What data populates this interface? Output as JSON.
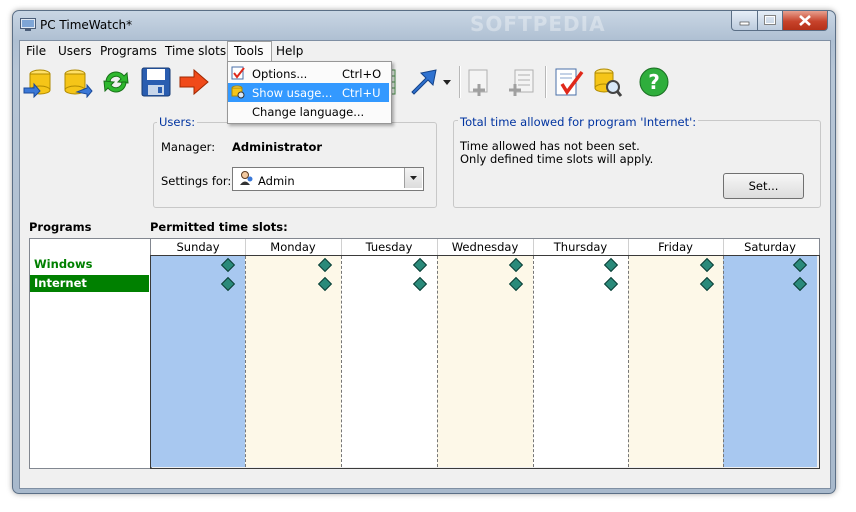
{
  "window": {
    "title": "PC TimeWatch*",
    "watermark": "SOFTPEDIA"
  },
  "menubar": {
    "items": [
      "File",
      "Users",
      "Programs",
      "Time slots",
      "Tools",
      "Help"
    ],
    "active": "Tools"
  },
  "tools_menu": {
    "items": [
      {
        "label": "Options...",
        "shortcut": "Ctrl+O",
        "icon": "options-icon"
      },
      {
        "label": "Show usage...",
        "shortcut": "Ctrl+U",
        "icon": "usage-icon",
        "selected": true
      },
      {
        "label": "Change language...",
        "shortcut": ""
      }
    ]
  },
  "users": {
    "legend": "Users:",
    "manager_label": "Manager:",
    "manager_value": "Administrator",
    "settings_label": "Settings for:",
    "settings_value": "Admin"
  },
  "total_time": {
    "legend": "Total time allowed for program 'Internet':",
    "line1": "Time allowed has not been set.",
    "line2": "Only defined time slots will apply.",
    "set_button": "Set..."
  },
  "programs": {
    "header": "Programs",
    "items": [
      {
        "name": "Windows",
        "selected": false
      },
      {
        "name": "Internet",
        "selected": true
      }
    ]
  },
  "time_slots": {
    "header": "Permitted time slots:",
    "days": [
      "Sunday",
      "Monday",
      "Tuesday",
      "Wednesday",
      "Thursday",
      "Friday",
      "Saturday"
    ]
  },
  "colors": {
    "weekend": "#a8c8f0",
    "weekday_alt": "#fdf8e8",
    "weekday": "#ffffff",
    "program_selected_bg": "#008000",
    "program_text": "#008000",
    "accent_blue": "#3399ff"
  }
}
